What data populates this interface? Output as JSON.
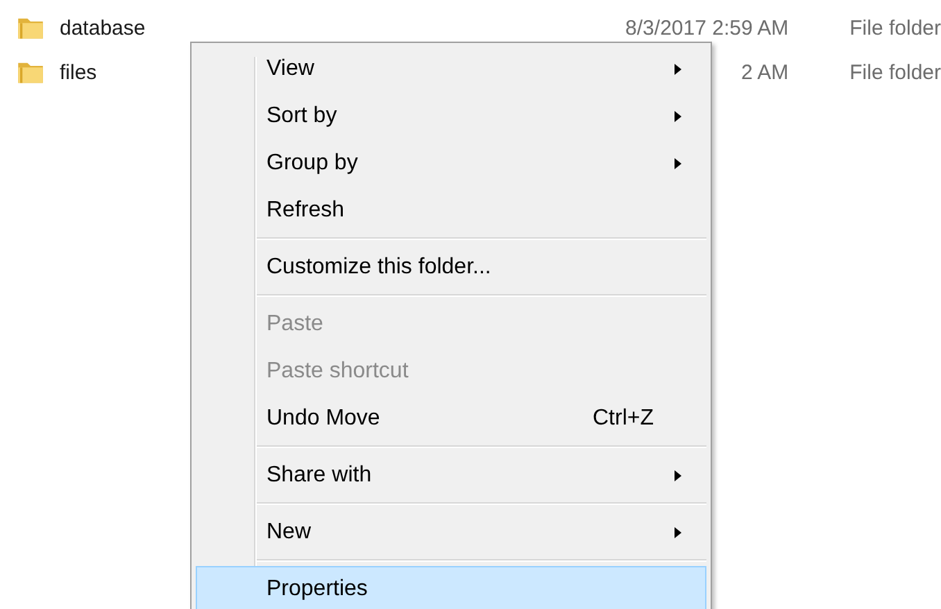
{
  "files": [
    {
      "name": "database",
      "date": "8/3/2017 2:59 AM",
      "type": "File folder"
    },
    {
      "name": "files",
      "date": "2 AM",
      "type": "File folder"
    }
  ],
  "context_menu": {
    "items": [
      {
        "kind": "item",
        "label": "View",
        "submenu": true,
        "disabled": false,
        "selected": false
      },
      {
        "kind": "item",
        "label": "Sort by",
        "submenu": true,
        "disabled": false,
        "selected": false
      },
      {
        "kind": "item",
        "label": "Group by",
        "submenu": true,
        "disabled": false,
        "selected": false
      },
      {
        "kind": "item",
        "label": "Refresh",
        "submenu": false,
        "disabled": false,
        "selected": false
      },
      {
        "kind": "separator"
      },
      {
        "kind": "item",
        "label": "Customize this folder...",
        "submenu": false,
        "disabled": false,
        "selected": false
      },
      {
        "kind": "separator"
      },
      {
        "kind": "item",
        "label": "Paste",
        "submenu": false,
        "disabled": true,
        "selected": false
      },
      {
        "kind": "item",
        "label": "Paste shortcut",
        "submenu": false,
        "disabled": true,
        "selected": false
      },
      {
        "kind": "item",
        "label": "Undo Move",
        "shortcut": "Ctrl+Z",
        "submenu": false,
        "disabled": false,
        "selected": false
      },
      {
        "kind": "separator"
      },
      {
        "kind": "item",
        "label": "Share with",
        "submenu": true,
        "disabled": false,
        "selected": false
      },
      {
        "kind": "separator"
      },
      {
        "kind": "item",
        "label": "New",
        "submenu": true,
        "disabled": false,
        "selected": false
      },
      {
        "kind": "separator"
      },
      {
        "kind": "item",
        "label": "Properties",
        "submenu": false,
        "disabled": false,
        "selected": true
      }
    ]
  }
}
